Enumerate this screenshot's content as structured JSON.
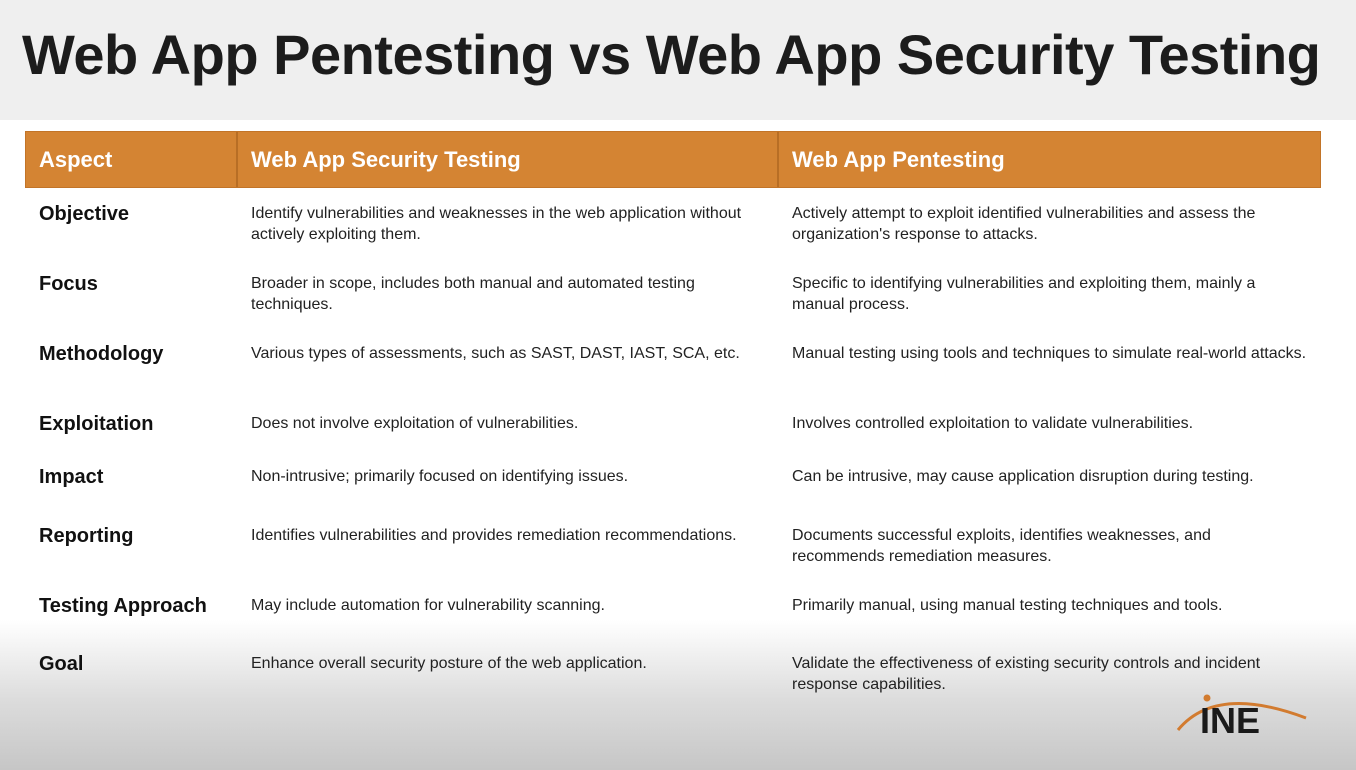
{
  "title": "Web App Pentesting vs Web App Security Testing",
  "table": {
    "headers": [
      "Aspect",
      "Web App Security Testing",
      "Web App Pentesting"
    ],
    "rows": [
      {
        "aspect": "Objective",
        "security_testing": "Identify vulnerabilities and weaknesses in the web application without actively exploiting them.",
        "pentesting": "Actively attempt to exploit identified vulnerabilities and assess the organization's response to attacks."
      },
      {
        "aspect": "Focus",
        "security_testing": "Broader in scope, includes both manual and automated testing techniques.",
        "pentesting": "Specific to identifying vulnerabilities and exploiting them, mainly a manual process."
      },
      {
        "aspect": "Methodology",
        "security_testing": "Various types of assessments, such as SAST, DAST, IAST, SCA, etc.",
        "pentesting": "Manual testing using tools and techniques to simulate real-world attacks."
      },
      {
        "aspect": "Exploitation",
        "security_testing": "Does not involve exploitation of vulnerabilities.",
        "pentesting": "Involves controlled exploitation to validate vulnerabilities."
      },
      {
        "aspect": "Impact",
        "security_testing": "Non-intrusive; primarily focused on identifying issues.",
        "pentesting": "Can be intrusive, may cause application disruption during testing."
      },
      {
        "aspect": "Reporting",
        "security_testing": "Identifies vulnerabilities and provides remediation recommendations.",
        "pentesting": "Documents successful exploits, identifies weaknesses, and recommends remediation measures."
      },
      {
        "aspect": "Testing Approach",
        "security_testing": "May include automation for vulnerability scanning.",
        "pentesting": "Primarily manual, using manual testing techniques and tools."
      },
      {
        "aspect": "Goal",
        "security_testing": "Enhance overall security posture of the web application.",
        "pentesting": "Validate the effectiveness of existing security controls and incident response capabilities."
      }
    ]
  },
  "logo": {
    "text": "INE",
    "colors": {
      "text": "#1a1a1a",
      "swoosh": "#d27b2f"
    }
  },
  "colors": {
    "header_bg": "#d48433",
    "header_text": "#ffffff",
    "title_bar_bg": "#efefef"
  }
}
